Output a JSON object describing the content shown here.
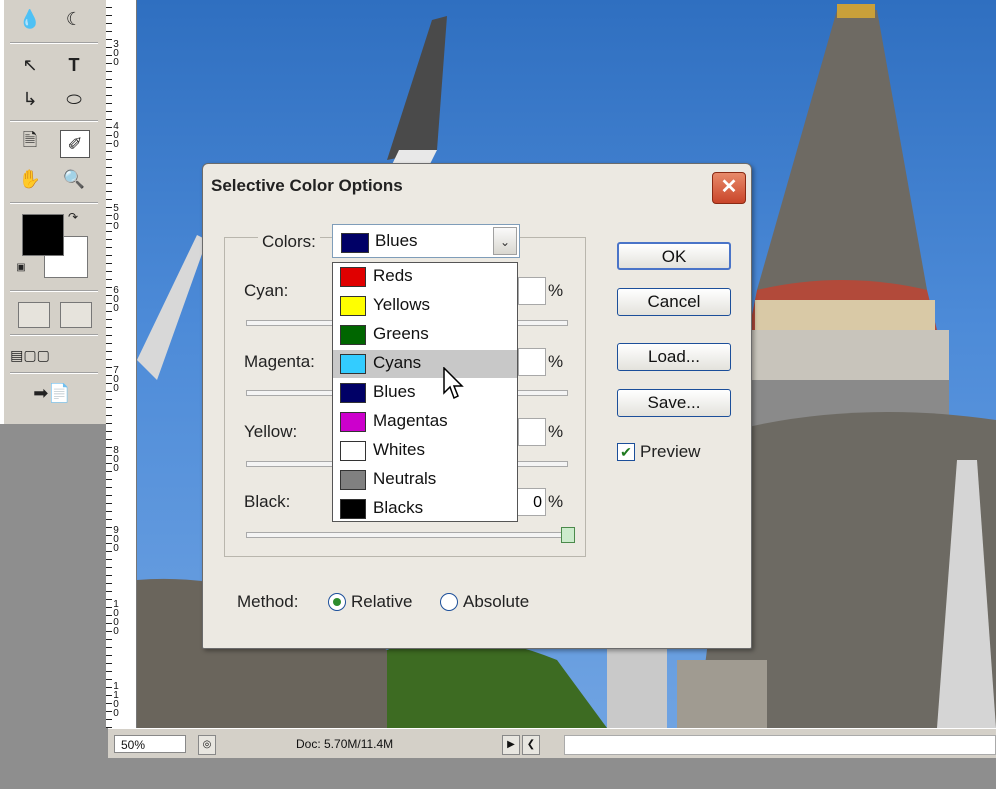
{
  "toolbox": {
    "icons": [
      "blur-icon",
      "dodge-icon",
      "path-select-icon",
      "type-icon",
      "pen-icon",
      "ellipse-icon",
      "notes-icon",
      "eyedropper-icon",
      "hand-icon",
      "zoom-icon"
    ]
  },
  "ruler": {
    "labels": [
      "300",
      "400",
      "500",
      "600",
      "700",
      "800",
      "900",
      "1000",
      "1100"
    ]
  },
  "statusbar": {
    "zoom": "50%",
    "doc": "Doc: 5.70M/11.4M"
  },
  "dialog": {
    "title": "Selective Color Options",
    "colors_label": "Colors:",
    "selected_color": {
      "label": "Blues",
      "hex": "#000066"
    },
    "options": [
      {
        "label": "Reds",
        "hex": "#e00000"
      },
      {
        "label": "Yellows",
        "hex": "#ffff00"
      },
      {
        "label": "Greens",
        "hex": "#006600"
      },
      {
        "label": "Cyans",
        "hex": "#33ccff"
      },
      {
        "label": "Blues",
        "hex": "#000066"
      },
      {
        "label": "Magentas",
        "hex": "#cc00cc"
      },
      {
        "label": "Whites",
        "hex": "#ffffff"
      },
      {
        "label": "Neutrals",
        "hex": "#808080"
      },
      {
        "label": "Blacks",
        "hex": "#000000"
      }
    ],
    "highlighted_option": "Cyans",
    "sliders": [
      {
        "label": "Cyan:",
        "value": "",
        "unit": "%"
      },
      {
        "label": "Magenta:",
        "value": "",
        "unit": "%"
      },
      {
        "label": "Yellow:",
        "value": "",
        "unit": "%"
      },
      {
        "label": "Black:",
        "value": "0",
        "unit": "%"
      }
    ],
    "buttons": {
      "ok": "OK",
      "cancel": "Cancel",
      "load": "Load...",
      "save": "Save..."
    },
    "preview_label": "Preview",
    "preview_checked": true,
    "method_label": "Method:",
    "method_options": [
      "Relative",
      "Absolute"
    ],
    "method_selected": "Relative"
  }
}
